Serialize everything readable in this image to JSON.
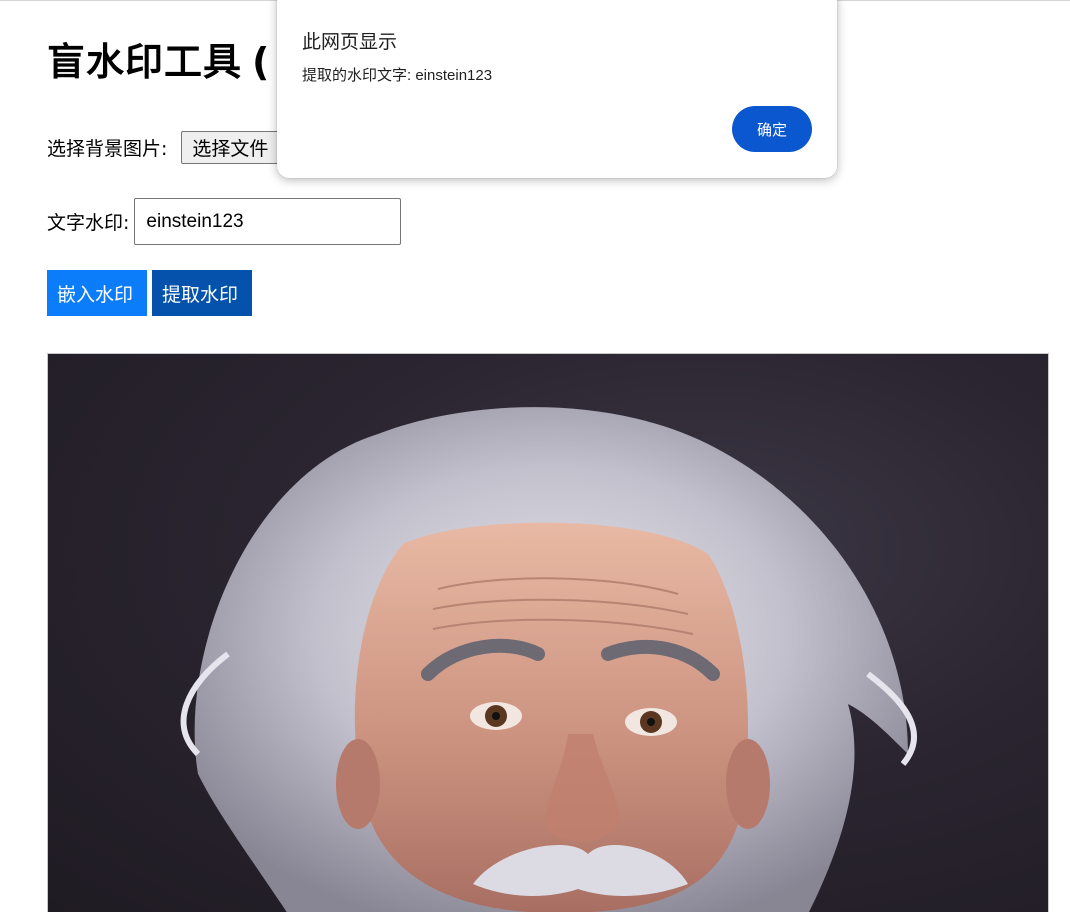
{
  "page": {
    "title": "盲水印工具",
    "title_suffix": "("
  },
  "form": {
    "file_label": "选择背景图片:",
    "file_button": "选择文件",
    "text_label": "文字水印:",
    "text_value": "einstein123"
  },
  "buttons": {
    "embed": "嵌入水印",
    "extract": "提取水印"
  },
  "dialog": {
    "title": "此网页显示",
    "message": "提取的水印文字: einstein123",
    "ok": "确定"
  },
  "colors": {
    "embed_button": "#0b7dfa",
    "extract_button": "#0552ad",
    "dialog_ok": "#0b57d0"
  }
}
